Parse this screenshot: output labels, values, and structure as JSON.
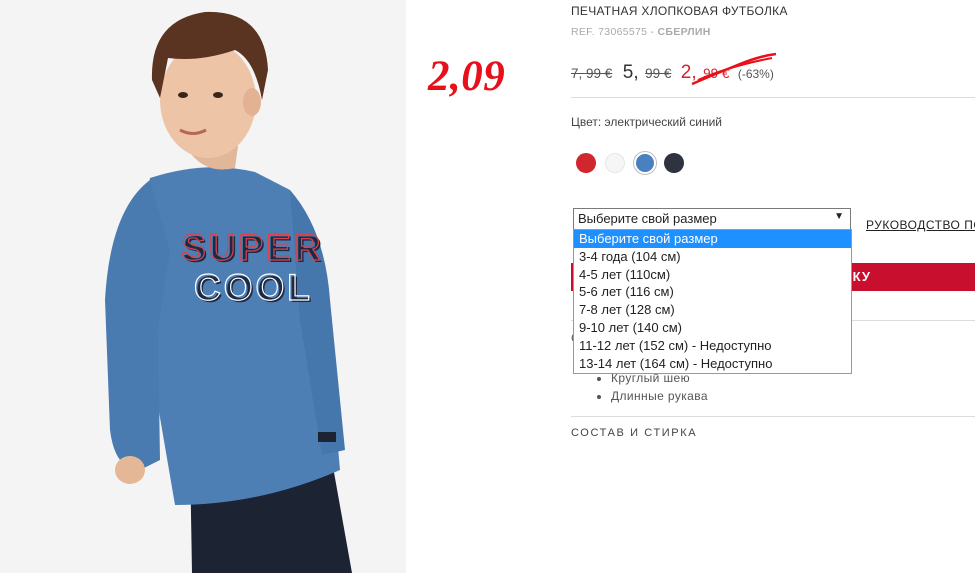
{
  "product": {
    "title": "ПЕЧАТНАЯ ХЛОПКОВАЯ ФУТБОЛКА",
    "ref_label": "REF. 73065575 -",
    "ref_code": "СБЕРЛИН",
    "annotation_price": "2,09",
    "prices": {
      "old": "7, 99 €",
      "mid": "5,",
      "mid_decimal": "99 €",
      "new": "2,",
      "new_decimal": "99 €",
      "discount": "(-63%)"
    },
    "color_label": "Цвет: электрический синий",
    "colors": [
      "#d0262d",
      "#f6f6f6",
      "#4a80bf",
      "#2f3340"
    ],
    "selected_color_index": 2,
    "size_select": {
      "value": "Выберите свой размер",
      "arrow": "▼",
      "options": [
        "Выберите свой размер",
        "3-4 года (104 см)",
        "4-5 лет (110см)",
        "5-6 лет (116 см)",
        "7-8 лет (128 см)",
        "9-10 лет (140 см)",
        "11-12 лет (152 см) - Недоступно",
        "13-14 лет (164 см) - Недоступно"
      ]
    },
    "size_guide": "РУКОВОДСТВО ПО",
    "add_button": "КУ",
    "desc_first_char": "С",
    "features": [
      "Круглый шею",
      "Длинные рукава"
    ],
    "composition": "СОСТАВ И СТИРКА",
    "photo_print": [
      "SUPER",
      "COOL"
    ]
  }
}
